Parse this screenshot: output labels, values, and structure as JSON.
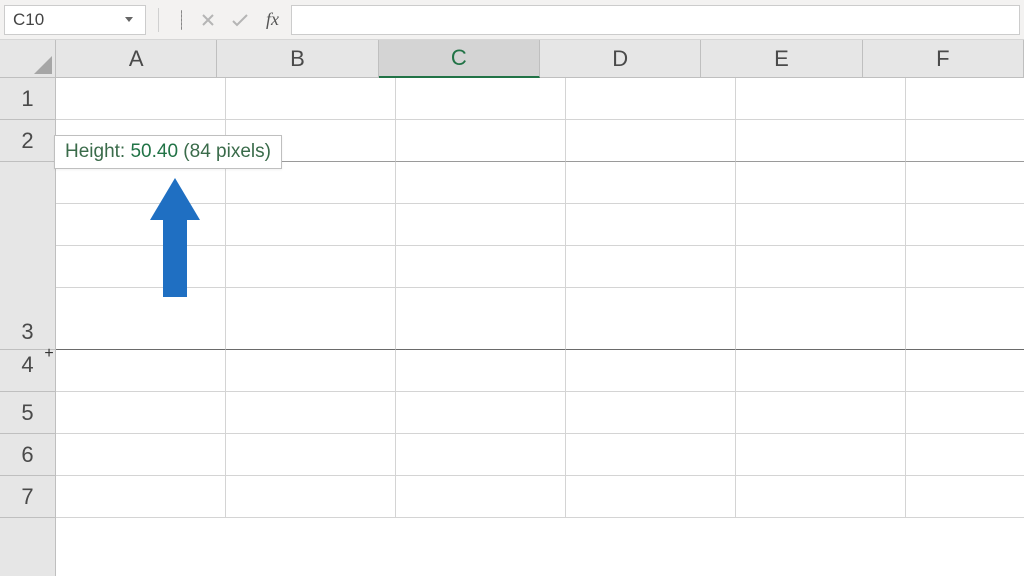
{
  "formula_bar": {
    "name_box_value": "C10",
    "fx_label": "fx",
    "formula_value": ""
  },
  "columns": [
    "A",
    "B",
    "C",
    "D",
    "E",
    "F"
  ],
  "selected_column": "C",
  "rows": [
    "1",
    "2",
    "3",
    "4",
    "5",
    "6",
    "7"
  ],
  "tooltip": {
    "label": "Height: ",
    "value": "50.40",
    "suffix": " (84 pixels)"
  },
  "resize_cursor_glyph": "+"
}
